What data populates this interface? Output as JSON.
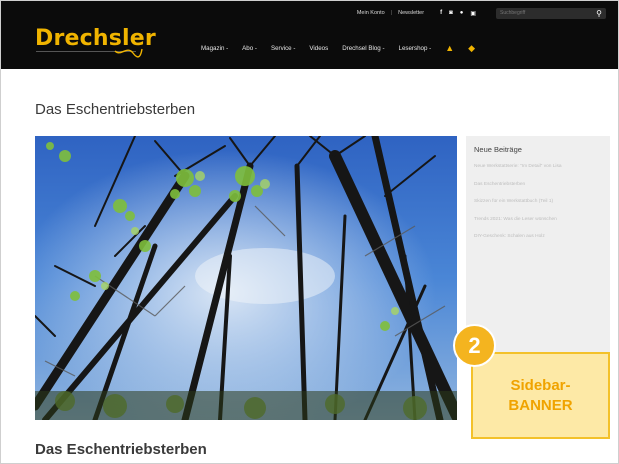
{
  "header": {
    "topbar": {
      "links": [
        "Mein Konto",
        "Newsletter"
      ],
      "social_icons": [
        "facebook-icon",
        "instagram-icon",
        "pinterest-icon",
        "youtube-icon"
      ],
      "search_placeholder": "Suchbegriff",
      "search_icon": "search-icon"
    },
    "logo": "Drechsler",
    "nav": [
      "Magazin -",
      "Abo -",
      "Service -",
      "Videos",
      "Drechsel Blog -",
      "Lesershop -"
    ],
    "nav_icons": [
      "bell-icon",
      "cart-icon"
    ],
    "accent_color": "#f0b400"
  },
  "page": {
    "title": "Das Eschentriebsterben",
    "article_title": "Das Eschentriebsterben",
    "hero_image": "trees-from-below-photo"
  },
  "sidebar": {
    "heading": "Neue Beiträge",
    "posts": [
      "Neue Werkstattserie: \"Im Detail\" von Lisa",
      "Das Eschentriebsterben",
      "Skizzen für ein Werkstattbuch (Teil 1)",
      "Trends 2021: Was die Leser wünschen",
      "DIY-Geschenk: Schalen aus Holz"
    ]
  },
  "callout": {
    "badge_number": "2",
    "banner_line1": "Sidebar-",
    "banner_line2": "BANNER"
  }
}
